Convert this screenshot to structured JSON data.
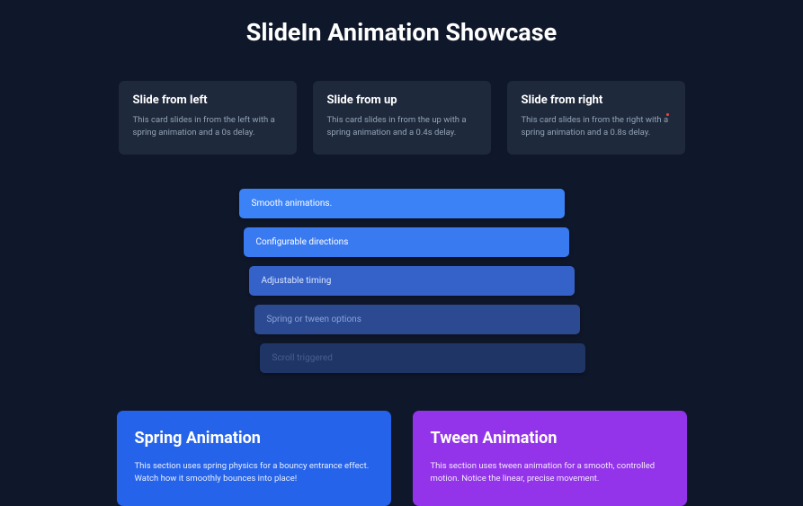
{
  "title": "SlideIn Animation Showcase",
  "cards": [
    {
      "title": "Slide from left",
      "desc": "This card slides in from the left with a spring animation and a 0s delay."
    },
    {
      "title": "Slide from up",
      "desc": "This card slides in from the up with a spring animation and a 0.4s delay."
    },
    {
      "title": "Slide from right",
      "desc": "This card slides in from the right with a spring animation and a 0.8s delay."
    }
  ],
  "bars": [
    "Smooth animations.",
    "Configurable directions",
    "Adjustable timing",
    "Spring or tween options",
    "Scroll triggered"
  ],
  "panels": {
    "spring": {
      "title": "Spring Animation",
      "desc": "This section uses spring physics for a bouncy entrance effect. Watch how it smoothly bounces into place!"
    },
    "tween": {
      "title": "Tween Animation",
      "desc": "This section uses tween animation for a smooth, controlled motion. Notice the linear, precise movement."
    }
  }
}
